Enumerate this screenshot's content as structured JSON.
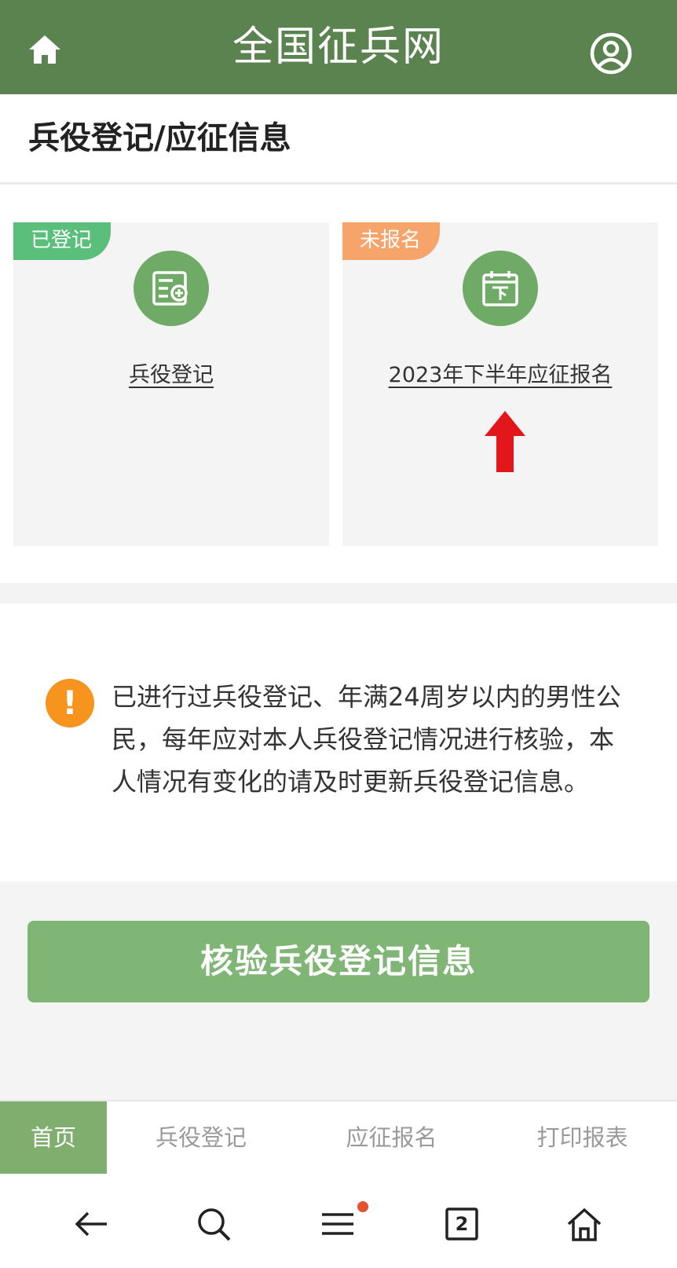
{
  "header": {
    "title": "全国征兵网",
    "home_icon": "home-icon",
    "user_icon": "user-circle-icon",
    "bg_color": "#5a834f"
  },
  "page": {
    "section_title": "兵役登记/应征信息"
  },
  "cards": [
    {
      "badge": "已登记",
      "badge_color": "#5bbf7c",
      "icon": "registration-form-icon",
      "link_label": "兵役登记"
    },
    {
      "badge": "未报名",
      "badge_color": "#f7a46a",
      "icon": "calendar-down-icon",
      "link_label": "2023年下半年应征报名"
    }
  ],
  "annotation": {
    "icon": "red-arrow-up-icon",
    "color": "#e3161c"
  },
  "notice": {
    "icon": "warning-icon",
    "text": "已进行过兵役登记、年满24周岁以内的男性公民，每年应对本人兵役登记情况进行核验，本人情况有变化的请及时更新兵役登记信息。"
  },
  "verify_button": {
    "label": "核验兵役登记信息",
    "color": "#7fb575"
  },
  "tabbar": {
    "tabs": [
      {
        "label": "首页",
        "active": true
      },
      {
        "label": "兵役登记",
        "active": false
      },
      {
        "label": "应征报名",
        "active": false
      },
      {
        "label": "打印报表",
        "active": false
      }
    ]
  },
  "system_bar": {
    "tab_count": "2",
    "icons": [
      "back-arrow-icon",
      "search-icon",
      "menu-icon",
      "tabs-icon",
      "home-icon"
    ]
  }
}
